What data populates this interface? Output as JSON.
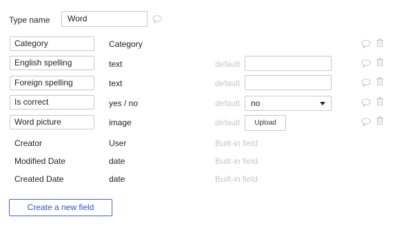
{
  "header": {
    "type_name_label": "Type name",
    "type_name_value": "Word"
  },
  "fields": [
    {
      "name": "Category",
      "type": "Category",
      "default_label": "",
      "default_control": "none"
    },
    {
      "name": "English spelling",
      "type": "text",
      "default_label": "default",
      "default_control": "text"
    },
    {
      "name": "Foreign spelling",
      "type": "text",
      "default_label": "default",
      "default_control": "text"
    },
    {
      "name": "Is correct",
      "type": "yes / no",
      "default_label": "default",
      "default_control": "select",
      "default_value": "no"
    },
    {
      "name": "Word picture",
      "type": "image",
      "default_label": "default",
      "default_control": "upload",
      "upload_label": "Upload"
    }
  ],
  "builtin_fields": [
    {
      "name": "Creator",
      "type": "User",
      "note": "Built-in field"
    },
    {
      "name": "Modified Date",
      "type": "date",
      "note": "Built-in field"
    },
    {
      "name": "Created Date",
      "type": "date",
      "note": "Built-in field"
    }
  ],
  "actions": {
    "create_field_label": "Create a new field"
  },
  "icons": {
    "comment": "comment-icon",
    "trash": "trash-icon"
  },
  "colors": {
    "accent": "#3a4cc8",
    "muted_text": "#c7c7c7",
    "border": "#c9c9c9"
  }
}
